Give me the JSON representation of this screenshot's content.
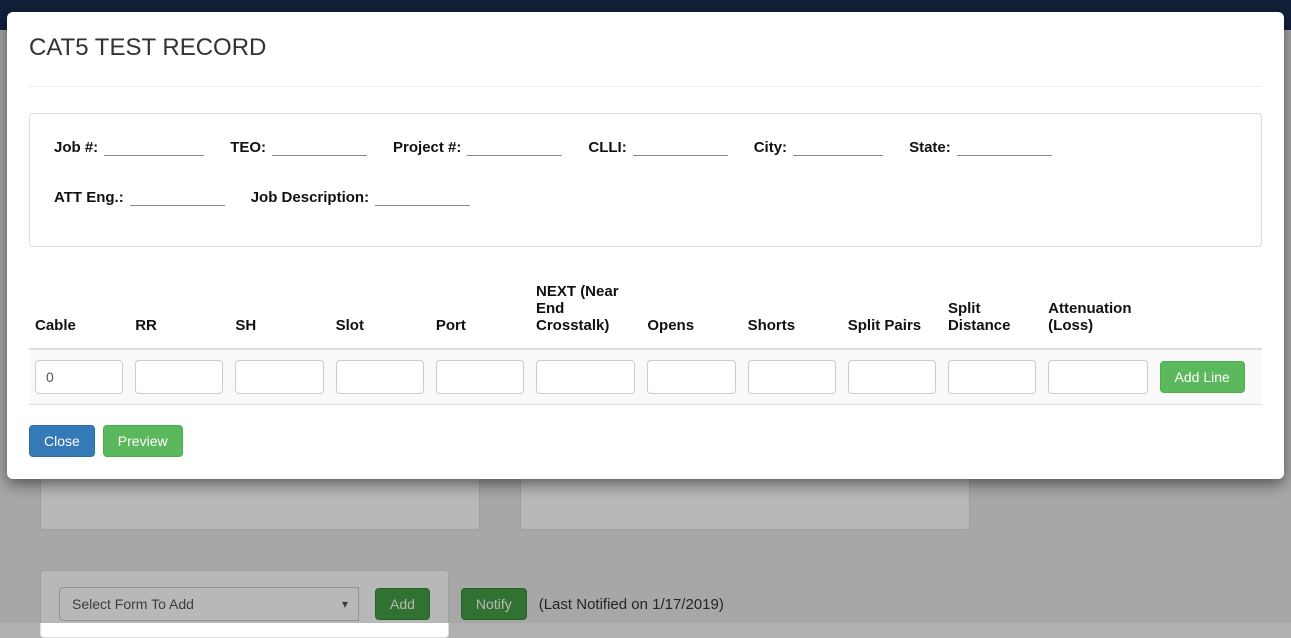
{
  "modal": {
    "title": "CAT5 TEST RECORD",
    "header_fields": {
      "job_label": "Job #:",
      "job_value": "",
      "teo_label": "TEO:",
      "teo_value": "",
      "project_label": "Project #:",
      "project_value": "",
      "clli_label": "CLLI:",
      "clli_value": "",
      "city_label": "City:",
      "city_value": "",
      "state_label": "State:",
      "state_value": "",
      "att_eng_label": "ATT Eng.:",
      "att_eng_value": "",
      "job_desc_label": "Job Description:",
      "job_desc_value": ""
    },
    "columns": {
      "cable": "Cable",
      "rr": "RR",
      "sh": "SH",
      "slot": "Slot",
      "port": "Port",
      "next": "NEXT (Near End Crosstalk)",
      "opens": "Opens",
      "shorts": "Shorts",
      "split_pairs": "Split Pairs",
      "split_distance": "Split Distance",
      "attenuation": "Attenuation (Loss)"
    },
    "rows": [
      {
        "cable": "0",
        "rr": "",
        "sh": "",
        "slot": "",
        "port": "",
        "next": "",
        "opens": "",
        "shorts": "",
        "split_pairs": "",
        "split_distance": "",
        "attenuation": ""
      }
    ],
    "buttons": {
      "add_line": "Add Line",
      "close": "Close",
      "preview": "Preview"
    }
  },
  "background": {
    "select_placeholder": "Select Form To Add",
    "add_button": "Add",
    "notify_button": "Notify",
    "last_notified": "(Last Notified on 1/17/2019)"
  }
}
